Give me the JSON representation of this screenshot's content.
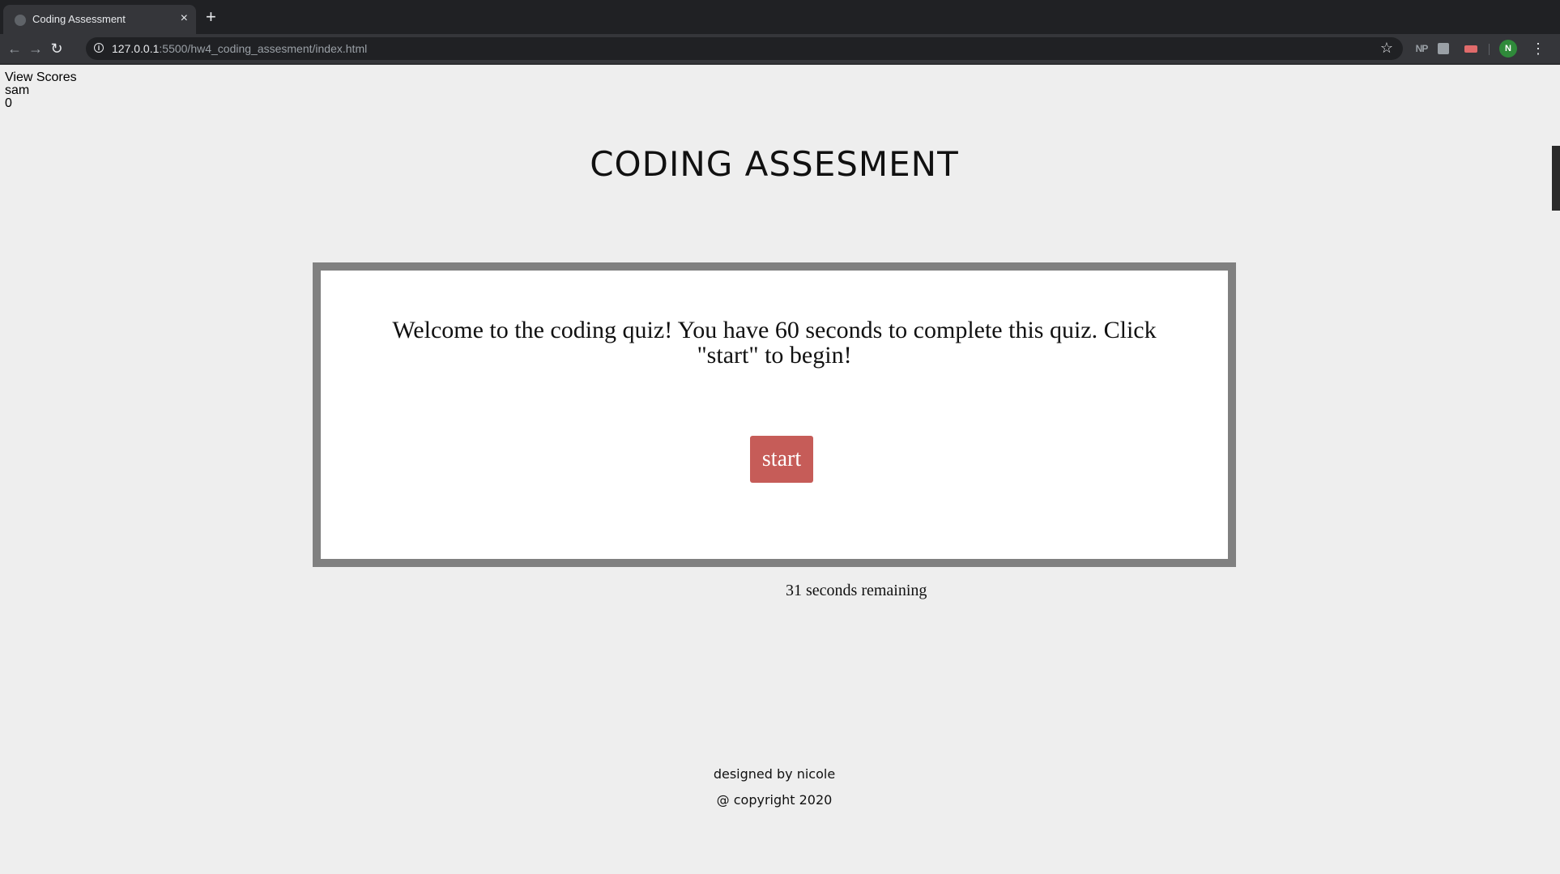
{
  "browser": {
    "tab_title": "Coding Assessment",
    "tab_close": "×",
    "new_tab": "+",
    "url_host": "127.0.0.1",
    "url_rest": ":5500/hw4_coding_assesment/index.html",
    "extensions": [
      "NP"
    ],
    "profile_initial": "N"
  },
  "page": {
    "view_scores": "View Scores",
    "score_name": "sam",
    "score_value": "0",
    "heading": "CODING ASSESMENT",
    "quiz_text": "Welcome to the coding quiz! You have 60 seconds to complete this quiz. Click \"start\" to begin!",
    "start_label": "start",
    "timer_text": "31 seconds remaining",
    "footer_designer": "designed by nicole",
    "footer_copyright": "@ copyright 2020"
  },
  "colors": {
    "page_background": "#eeeeee",
    "quiz_border": "#808080",
    "start_button": "#c65c58",
    "chrome_dark": "#202124"
  }
}
